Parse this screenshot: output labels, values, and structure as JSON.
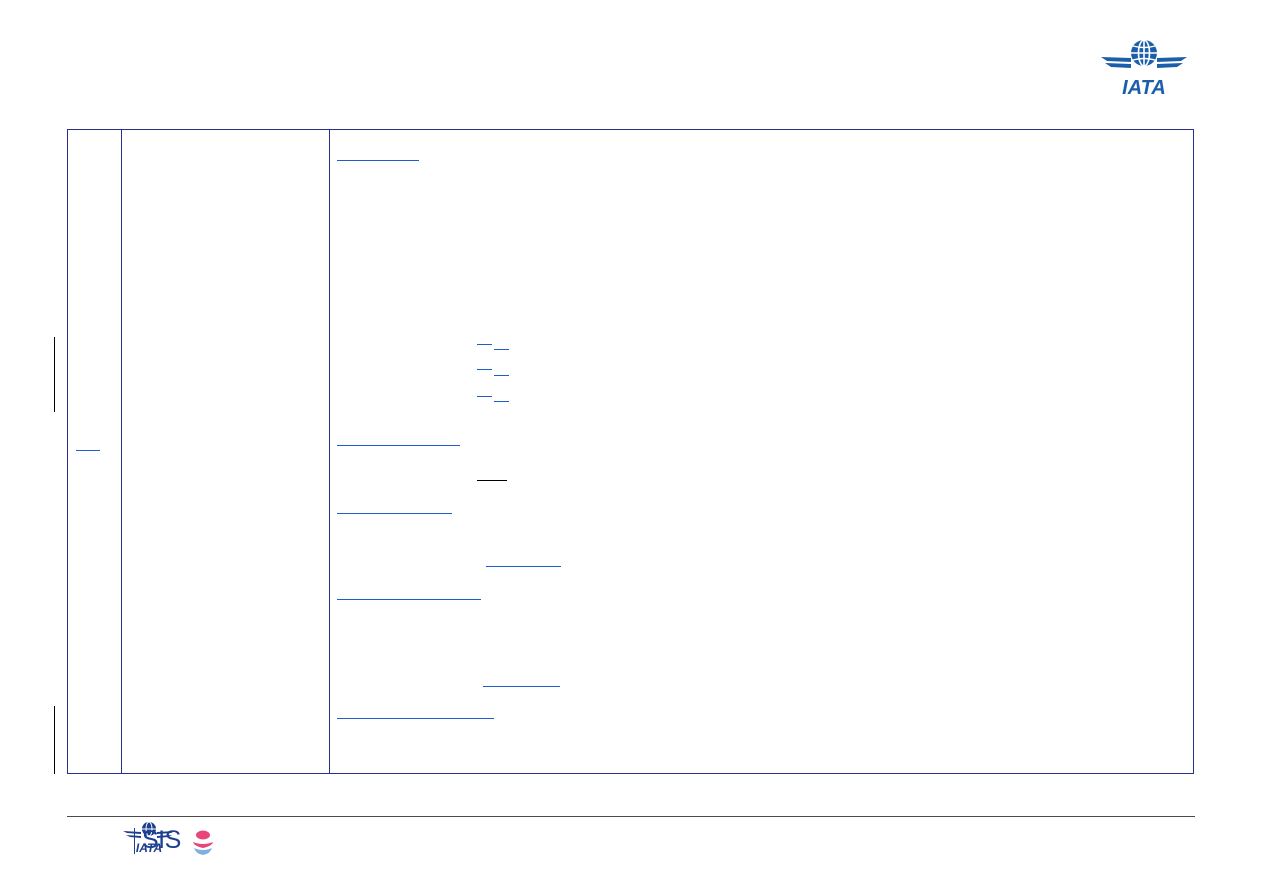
{
  "header": {
    "logo_text": "IATA",
    "logo_colors": {
      "primary": "#1c5fa8"
    }
  },
  "table": {
    "border_color": "#2b2e8c",
    "link_underline_color": "#1f5ec9"
  },
  "footer": {
    "iata_logo_text": "IATA",
    "product_name": "SIS",
    "colors": {
      "brand_blue": "#1d3f8f",
      "accent_pink": "#e8457a",
      "accent_blue": "#7fb0e0"
    }
  }
}
